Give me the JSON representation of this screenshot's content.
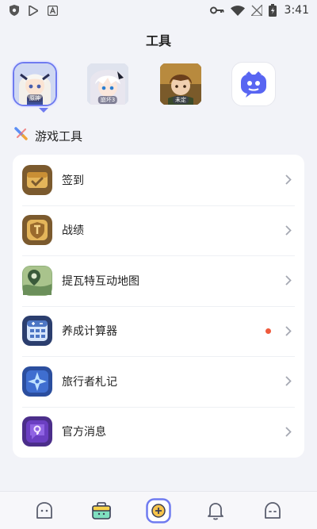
{
  "status_bar": {
    "time": "3:41",
    "left_icons": [
      "shield-icon",
      "play-store-icon",
      "app-a-icon"
    ],
    "right_icons": [
      "key-icon",
      "wifi-icon",
      "no-signal-icon",
      "battery-icon"
    ]
  },
  "page": {
    "title": "工具"
  },
  "games": [
    {
      "name": "genshin-avatar",
      "badge": "原神",
      "selected": true
    },
    {
      "name": "honkai-avatar",
      "badge": "崩坏3",
      "selected": false
    },
    {
      "name": "tears-of-themis-avatar",
      "badge": "未定",
      "selected": false
    },
    {
      "name": "discord-avatar",
      "badge": "",
      "selected": false
    }
  ],
  "section": {
    "title": "游戏工具",
    "icon": "pen-icon"
  },
  "tools": [
    {
      "label": "签到",
      "icon": "checkin-chest-icon",
      "dot": false
    },
    {
      "label": "战绩",
      "icon": "record-shield-icon",
      "dot": false
    },
    {
      "label": "提瓦特互动地图",
      "icon": "map-pin-icon",
      "dot": false
    },
    {
      "label": "养成计算器",
      "icon": "calculator-icon",
      "dot": true
    },
    {
      "label": "旅行者札记",
      "icon": "star-compass-icon",
      "dot": false
    },
    {
      "label": "官方消息",
      "icon": "message-key-icon",
      "dot": false
    }
  ],
  "bottom_nav": [
    "home-icon",
    "toolbox-icon",
    "create-post-icon",
    "bell-icon",
    "profile-icon"
  ],
  "colors": {
    "accent": "#6f7bf0",
    "background": "#f2f3f8",
    "card": "#ffffff",
    "red_dot": "#ef5a3c"
  }
}
